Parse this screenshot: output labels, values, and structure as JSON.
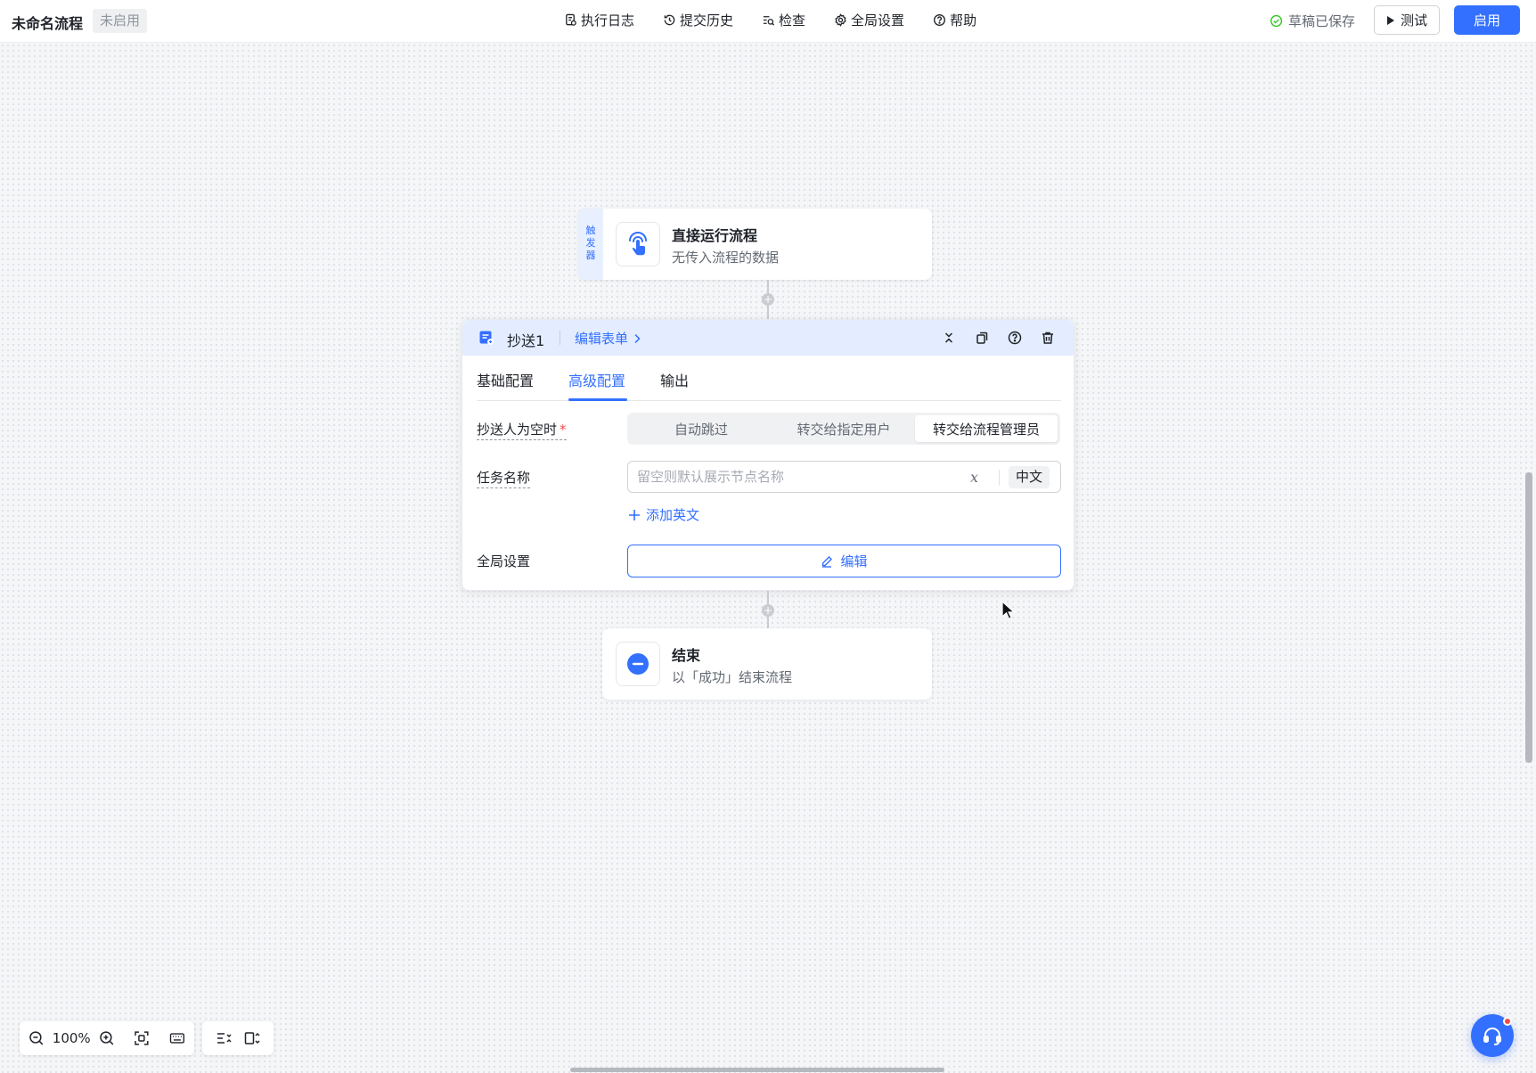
{
  "header": {
    "title": "未命名流程",
    "status": "未启用",
    "nav": [
      {
        "label": "执行日志",
        "icon": "log-icon"
      },
      {
        "label": "提交历史",
        "icon": "history-icon"
      },
      {
        "label": "检查",
        "icon": "inspect-icon"
      },
      {
        "label": "全局设置",
        "icon": "gear-icon"
      },
      {
        "label": "帮助",
        "icon": "help-icon"
      }
    ],
    "saved_text": "草稿已保存",
    "test_label": "测试",
    "enable_label": "启用"
  },
  "trigger_node": {
    "tag": "触发器",
    "title": "直接运行流程",
    "subtitle": "无传入流程的数据",
    "icon": "tap-hand-icon"
  },
  "panel": {
    "title": "抄送1",
    "edit_form": "编辑表单",
    "tabs": [
      "基础配置",
      "高级配置",
      "输出"
    ],
    "active_tab": "高级配置",
    "empty_cc_label": "抄送人为空时",
    "empty_cc_options": [
      "自动跳过",
      "转交给指定用户",
      "转交给流程管理员"
    ],
    "empty_cc_selected": "转交给流程管理员",
    "task_name_label": "任务名称",
    "task_name_placeholder": "留空则默认展示节点名称",
    "task_name_value": "",
    "lang": "中文",
    "add_english": "添加英文",
    "global_label": "全局设置",
    "edit_label": "编辑"
  },
  "end_node": {
    "title": "结束",
    "subtitle": "以「成功」结束流程",
    "icon": "minus-circle-icon"
  },
  "zoom": {
    "value": "100%"
  },
  "colors": {
    "accent": "#3370ff",
    "success": "#34c724",
    "danger": "#f54a45"
  }
}
